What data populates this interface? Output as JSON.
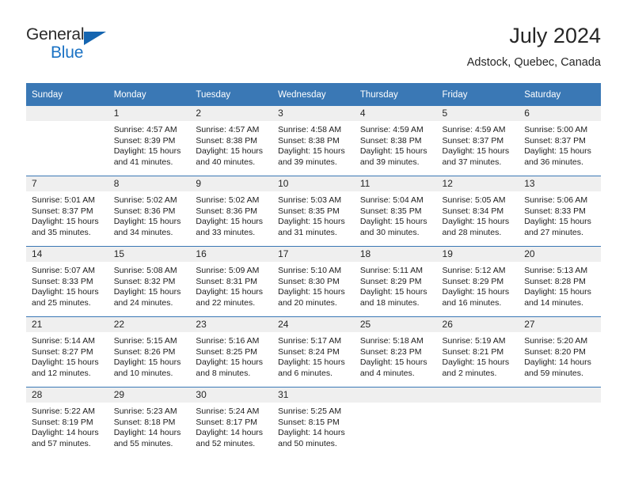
{
  "logo": {
    "word_one": "General",
    "word_two": "Blue",
    "triangle_color": "#1565b0",
    "blue_color": "#1a72c4"
  },
  "header": {
    "title": "July 2024",
    "location": "Adstock, Quebec, Canada"
  },
  "theme": {
    "header_row_bg": "#3a78b5",
    "daynum_bg": "#efefef",
    "separator": "#3a78b5"
  },
  "weekdays": [
    "Sunday",
    "Monday",
    "Tuesday",
    "Wednesday",
    "Thursday",
    "Friday",
    "Saturday"
  ],
  "weeks": [
    [
      {
        "day": "",
        "sunrise": "",
        "sunset": "",
        "daylight1": "",
        "daylight2": ""
      },
      {
        "day": "1",
        "sunrise": "Sunrise: 4:57 AM",
        "sunset": "Sunset: 8:39 PM",
        "daylight1": "Daylight: 15 hours",
        "daylight2": "and 41 minutes."
      },
      {
        "day": "2",
        "sunrise": "Sunrise: 4:57 AM",
        "sunset": "Sunset: 8:38 PM",
        "daylight1": "Daylight: 15 hours",
        "daylight2": "and 40 minutes."
      },
      {
        "day": "3",
        "sunrise": "Sunrise: 4:58 AM",
        "sunset": "Sunset: 8:38 PM",
        "daylight1": "Daylight: 15 hours",
        "daylight2": "and 39 minutes."
      },
      {
        "day": "4",
        "sunrise": "Sunrise: 4:59 AM",
        "sunset": "Sunset: 8:38 PM",
        "daylight1": "Daylight: 15 hours",
        "daylight2": "and 39 minutes."
      },
      {
        "day": "5",
        "sunrise": "Sunrise: 4:59 AM",
        "sunset": "Sunset: 8:37 PM",
        "daylight1": "Daylight: 15 hours",
        "daylight2": "and 37 minutes."
      },
      {
        "day": "6",
        "sunrise": "Sunrise: 5:00 AM",
        "sunset": "Sunset: 8:37 PM",
        "daylight1": "Daylight: 15 hours",
        "daylight2": "and 36 minutes."
      }
    ],
    [
      {
        "day": "7",
        "sunrise": "Sunrise: 5:01 AM",
        "sunset": "Sunset: 8:37 PM",
        "daylight1": "Daylight: 15 hours",
        "daylight2": "and 35 minutes."
      },
      {
        "day": "8",
        "sunrise": "Sunrise: 5:02 AM",
        "sunset": "Sunset: 8:36 PM",
        "daylight1": "Daylight: 15 hours",
        "daylight2": "and 34 minutes."
      },
      {
        "day": "9",
        "sunrise": "Sunrise: 5:02 AM",
        "sunset": "Sunset: 8:36 PM",
        "daylight1": "Daylight: 15 hours",
        "daylight2": "and 33 minutes."
      },
      {
        "day": "10",
        "sunrise": "Sunrise: 5:03 AM",
        "sunset": "Sunset: 8:35 PM",
        "daylight1": "Daylight: 15 hours",
        "daylight2": "and 31 minutes."
      },
      {
        "day": "11",
        "sunrise": "Sunrise: 5:04 AM",
        "sunset": "Sunset: 8:35 PM",
        "daylight1": "Daylight: 15 hours",
        "daylight2": "and 30 minutes."
      },
      {
        "day": "12",
        "sunrise": "Sunrise: 5:05 AM",
        "sunset": "Sunset: 8:34 PM",
        "daylight1": "Daylight: 15 hours",
        "daylight2": "and 28 minutes."
      },
      {
        "day": "13",
        "sunrise": "Sunrise: 5:06 AM",
        "sunset": "Sunset: 8:33 PM",
        "daylight1": "Daylight: 15 hours",
        "daylight2": "and 27 minutes."
      }
    ],
    [
      {
        "day": "14",
        "sunrise": "Sunrise: 5:07 AM",
        "sunset": "Sunset: 8:33 PM",
        "daylight1": "Daylight: 15 hours",
        "daylight2": "and 25 minutes."
      },
      {
        "day": "15",
        "sunrise": "Sunrise: 5:08 AM",
        "sunset": "Sunset: 8:32 PM",
        "daylight1": "Daylight: 15 hours",
        "daylight2": "and 24 minutes."
      },
      {
        "day": "16",
        "sunrise": "Sunrise: 5:09 AM",
        "sunset": "Sunset: 8:31 PM",
        "daylight1": "Daylight: 15 hours",
        "daylight2": "and 22 minutes."
      },
      {
        "day": "17",
        "sunrise": "Sunrise: 5:10 AM",
        "sunset": "Sunset: 8:30 PM",
        "daylight1": "Daylight: 15 hours",
        "daylight2": "and 20 minutes."
      },
      {
        "day": "18",
        "sunrise": "Sunrise: 5:11 AM",
        "sunset": "Sunset: 8:29 PM",
        "daylight1": "Daylight: 15 hours",
        "daylight2": "and 18 minutes."
      },
      {
        "day": "19",
        "sunrise": "Sunrise: 5:12 AM",
        "sunset": "Sunset: 8:29 PM",
        "daylight1": "Daylight: 15 hours",
        "daylight2": "and 16 minutes."
      },
      {
        "day": "20",
        "sunrise": "Sunrise: 5:13 AM",
        "sunset": "Sunset: 8:28 PM",
        "daylight1": "Daylight: 15 hours",
        "daylight2": "and 14 minutes."
      }
    ],
    [
      {
        "day": "21",
        "sunrise": "Sunrise: 5:14 AM",
        "sunset": "Sunset: 8:27 PM",
        "daylight1": "Daylight: 15 hours",
        "daylight2": "and 12 minutes."
      },
      {
        "day": "22",
        "sunrise": "Sunrise: 5:15 AM",
        "sunset": "Sunset: 8:26 PM",
        "daylight1": "Daylight: 15 hours",
        "daylight2": "and 10 minutes."
      },
      {
        "day": "23",
        "sunrise": "Sunrise: 5:16 AM",
        "sunset": "Sunset: 8:25 PM",
        "daylight1": "Daylight: 15 hours",
        "daylight2": "and 8 minutes."
      },
      {
        "day": "24",
        "sunrise": "Sunrise: 5:17 AM",
        "sunset": "Sunset: 8:24 PM",
        "daylight1": "Daylight: 15 hours",
        "daylight2": "and 6 minutes."
      },
      {
        "day": "25",
        "sunrise": "Sunrise: 5:18 AM",
        "sunset": "Sunset: 8:23 PM",
        "daylight1": "Daylight: 15 hours",
        "daylight2": "and 4 minutes."
      },
      {
        "day": "26",
        "sunrise": "Sunrise: 5:19 AM",
        "sunset": "Sunset: 8:21 PM",
        "daylight1": "Daylight: 15 hours",
        "daylight2": "and 2 minutes."
      },
      {
        "day": "27",
        "sunrise": "Sunrise: 5:20 AM",
        "sunset": "Sunset: 8:20 PM",
        "daylight1": "Daylight: 14 hours",
        "daylight2": "and 59 minutes."
      }
    ],
    [
      {
        "day": "28",
        "sunrise": "Sunrise: 5:22 AM",
        "sunset": "Sunset: 8:19 PM",
        "daylight1": "Daylight: 14 hours",
        "daylight2": "and 57 minutes."
      },
      {
        "day": "29",
        "sunrise": "Sunrise: 5:23 AM",
        "sunset": "Sunset: 8:18 PM",
        "daylight1": "Daylight: 14 hours",
        "daylight2": "and 55 minutes."
      },
      {
        "day": "30",
        "sunrise": "Sunrise: 5:24 AM",
        "sunset": "Sunset: 8:17 PM",
        "daylight1": "Daylight: 14 hours",
        "daylight2": "and 52 minutes."
      },
      {
        "day": "31",
        "sunrise": "Sunrise: 5:25 AM",
        "sunset": "Sunset: 8:15 PM",
        "daylight1": "Daylight: 14 hours",
        "daylight2": "and 50 minutes."
      },
      {
        "day": "",
        "sunrise": "",
        "sunset": "",
        "daylight1": "",
        "daylight2": ""
      },
      {
        "day": "",
        "sunrise": "",
        "sunset": "",
        "daylight1": "",
        "daylight2": ""
      },
      {
        "day": "",
        "sunrise": "",
        "sunset": "",
        "daylight1": "",
        "daylight2": ""
      }
    ]
  ]
}
